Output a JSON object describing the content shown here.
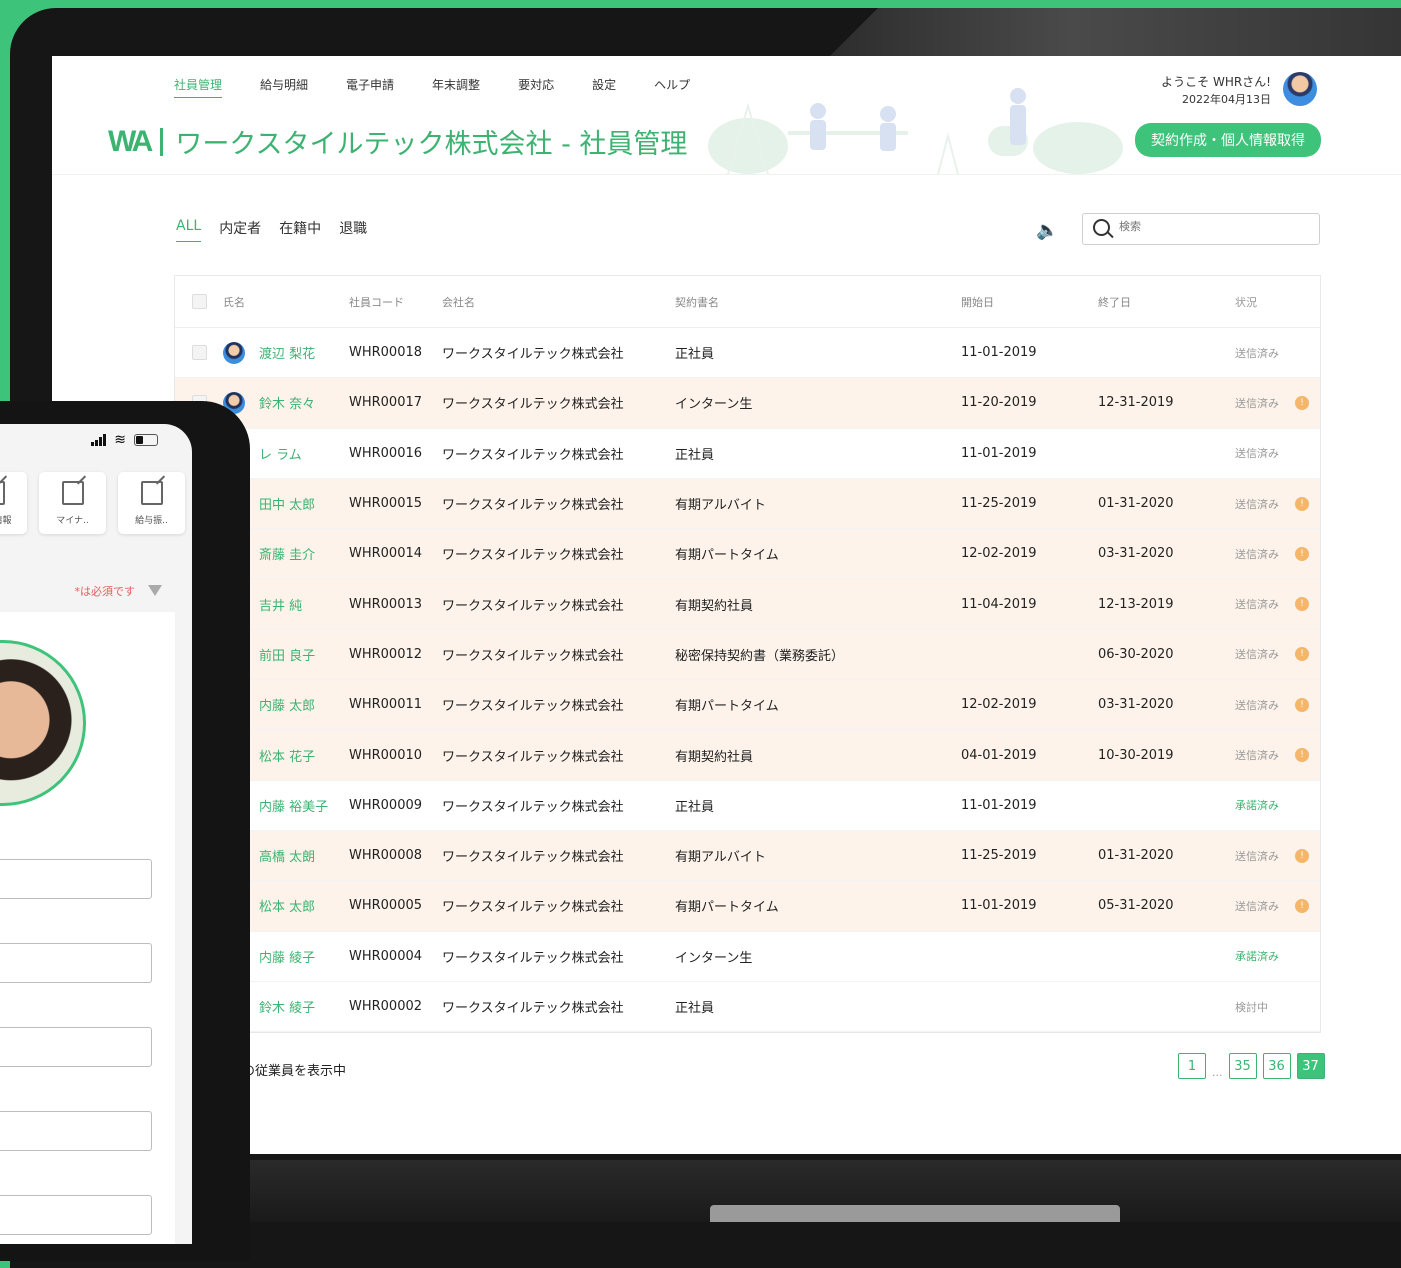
{
  "nav": [
    "社員管理",
    "給与明細",
    "電子申請",
    "年末調整",
    "要対応",
    "設定",
    "ヘルプ"
  ],
  "header": {
    "logo_mark": "WA",
    "title": "ワークスタイルテック株式会社 - 社員管理",
    "welcome": "ようこそ WHRさん!",
    "date": "2022年04月13日",
    "contract_button": "契約作成・個人情報取得"
  },
  "tabs": [
    "ALL",
    "内定者",
    "在籍中",
    "退職"
  ],
  "search": {
    "placeholder": "検索"
  },
  "columns": [
    "氏名",
    "社員コード",
    "会社名",
    "契約書名",
    "開始日",
    "終了日",
    "状況"
  ],
  "rows": [
    {
      "name": "渡辺 梨花",
      "code": "WHR00018",
      "company": "ワークスタイルテック株式会社",
      "doc": "正社員",
      "start": "11-01-2019",
      "end": "",
      "status": "送信済み",
      "alert": false
    },
    {
      "name": "鈴木 奈々",
      "code": "WHR00017",
      "company": "ワークスタイルテック株式会社",
      "doc": "インターン生",
      "start": "11-20-2019",
      "end": "12-31-2019",
      "status": "送信済み",
      "alert": true
    },
    {
      "name": "レ ラム",
      "code": "WHR00016",
      "company": "ワークスタイルテック株式会社",
      "doc": "正社員",
      "start": "11-01-2019",
      "end": "",
      "status": "送信済み",
      "alert": false
    },
    {
      "name": "田中 太郎",
      "code": "WHR00015",
      "company": "ワークスタイルテック株式会社",
      "doc": "有期アルバイト",
      "start": "11-25-2019",
      "end": "01-31-2020",
      "status": "送信済み",
      "alert": true
    },
    {
      "name": "斎藤 圭介",
      "code": "WHR00014",
      "company": "ワークスタイルテック株式会社",
      "doc": "有期パートタイム",
      "start": "12-02-2019",
      "end": "03-31-2020",
      "status": "送信済み",
      "alert": true
    },
    {
      "name": "吉井 純",
      "code": "WHR00013",
      "company": "ワークスタイルテック株式会社",
      "doc": "有期契約社員",
      "start": "11-04-2019",
      "end": "12-13-2019",
      "status": "送信済み",
      "alert": true
    },
    {
      "name": "前田 良子",
      "code": "WHR00012",
      "company": "ワークスタイルテック株式会社",
      "doc": "秘密保持契約書（業務委託）",
      "start": "",
      "end": "06-30-2020",
      "status": "送信済み",
      "alert": true
    },
    {
      "name": "内藤 太郎",
      "code": "WHR00011",
      "company": "ワークスタイルテック株式会社",
      "doc": "有期パートタイム",
      "start": "12-02-2019",
      "end": "03-31-2020",
      "status": "送信済み",
      "alert": true
    },
    {
      "name": "松本 花子",
      "code": "WHR00010",
      "company": "ワークスタイルテック株式会社",
      "doc": "有期契約社員",
      "start": "04-01-2019",
      "end": "10-30-2019",
      "status": "送信済み",
      "alert": true
    },
    {
      "name": "内藤 裕美子",
      "code": "WHR00009",
      "company": "ワークスタイルテック株式会社",
      "doc": "正社員",
      "start": "11-01-2019",
      "end": "",
      "status": "承諾済み",
      "alert": false
    },
    {
      "name": "高橋 太朗",
      "code": "WHR00008",
      "company": "ワークスタイルテック株式会社",
      "doc": "有期アルバイト",
      "start": "11-25-2019",
      "end": "01-31-2020",
      "status": "送信済み",
      "alert": true
    },
    {
      "name": "松本 太郎",
      "code": "WHR00005",
      "company": "ワークスタイルテック株式会社",
      "doc": "有期パートタイム",
      "start": "11-01-2019",
      "end": "05-31-2020",
      "status": "送信済み",
      "alert": true
    },
    {
      "name": "内藤 綾子",
      "code": "WHR00004",
      "company": "ワークスタイルテック株式会社",
      "doc": "インターン生",
      "start": "",
      "end": "",
      "status": "承諾済み",
      "alert": false
    },
    {
      "name": "鈴木 綾子",
      "code": "WHR00002",
      "company": "ワークスタイルテック株式会社",
      "doc": "正社員",
      "start": "",
      "end": "",
      "status": "検討中",
      "alert": false
    }
  ],
  "footer_text": "の従業員を表示中",
  "pager": {
    "first": "1",
    "ellipsis": "...",
    "pages": [
      "35",
      "36",
      "37"
    ],
    "current": "37"
  },
  "phone": {
    "cards": [
      "雇用情報",
      "マイナ..",
      "給与振.."
    ],
    "required_note": "*は必須です"
  },
  "colors": {
    "accent": "#3ec37a",
    "warn_row": "#fdf3eb",
    "alert": "#f5b66a"
  }
}
